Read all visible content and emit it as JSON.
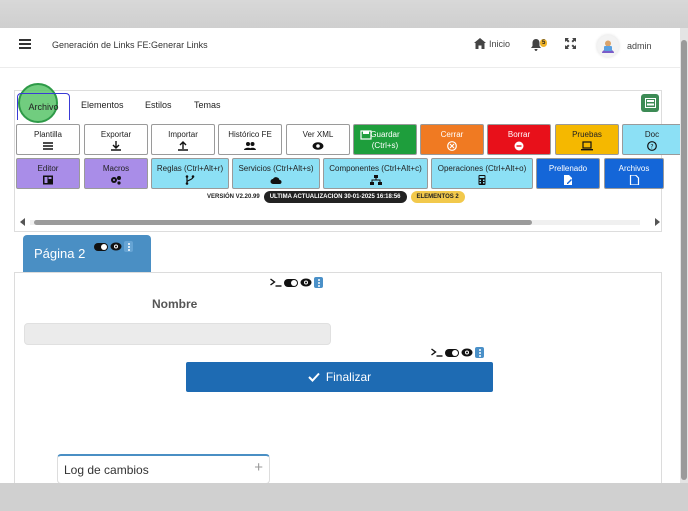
{
  "header": {
    "title": "Generación de Links FE:Generar Links",
    "home_label": "Inicio",
    "notification_count": "5",
    "user_name": "admin"
  },
  "editor": {
    "tabs": [
      "Archivo",
      "Elementos",
      "Estilos",
      "Temas"
    ],
    "active_tab": "Archivo",
    "row1": [
      {
        "line1": "Plantilla",
        "line2": "",
        "icon": "list-icon",
        "color": "#ffffff"
      },
      {
        "line1": "Exportar",
        "line2": "",
        "icon": "download-icon",
        "color": "#ffffff"
      },
      {
        "line1": "Importar",
        "line2": "",
        "icon": "upload-icon",
        "color": "#ffffff"
      },
      {
        "line1": "Histórico FE",
        "line2": "",
        "icon": "users-icon",
        "color": "#ffffff"
      },
      {
        "line1": "Ver XML",
        "line2": "",
        "icon": "eye-icon",
        "color": "#ffffff"
      },
      {
        "line1": "Guardar",
        "line2": "(Ctrl+s)",
        "icon": "save-icon",
        "color": "#1e9e3c"
      },
      {
        "line1": "Cerrar",
        "line2": "",
        "icon": "close-circle-icon",
        "color": "#f07a22"
      },
      {
        "line1": "Borrar",
        "line2": "",
        "icon": "minus-circle-icon",
        "color": "#e8101a"
      },
      {
        "line1": "Pruebas",
        "line2": "",
        "icon": "laptop-icon",
        "color": "#f5b800"
      },
      {
        "line1": "Doc",
        "line2": "",
        "icon": "help-circle-icon",
        "color": "#8ce0f5"
      }
    ],
    "row2": [
      {
        "line1": "Editor",
        "line2": "",
        "icon": "layout-icon",
        "color": "#a98de8"
      },
      {
        "line1": "Macros",
        "line2": "",
        "icon": "gears-icon",
        "color": "#a98de8"
      },
      {
        "line1": "Reglas (Ctrl+Alt+r)",
        "line2": "",
        "icon": "branch-icon",
        "color": "#8ce0f5"
      },
      {
        "line1": "Servicios (Ctrl+Alt+s)",
        "line2": "",
        "icon": "cloud-icon",
        "color": "#8ce0f5"
      },
      {
        "line1": "Componentes (Ctrl+Alt+c)",
        "line2": "",
        "icon": "sitemap-icon",
        "color": "#8ce0f5"
      },
      {
        "line1": "Operaciones (Ctrl+Alt+o)",
        "line2": "",
        "icon": "calculator-icon",
        "color": "#8ce0f5"
      },
      {
        "line1": "Prellenado",
        "line2": "",
        "icon": "file-edit-icon",
        "color": "#1466d8"
      },
      {
        "line1": "Archivos",
        "line2": "",
        "icon": "file-icon",
        "color": "#1466d8"
      }
    ],
    "version": "VERSIÓN V2.20.99",
    "last_update": "ULTIMA ACTUALIZACION 30-01-2025 16:18:56",
    "elements": "ELEMENTOS 2"
  },
  "page": {
    "tab_label": "Página 2",
    "field_label": "Nombre",
    "finalize_label": "Finalizar",
    "log_label": "Log de cambios"
  },
  "colors": {
    "accent": "#1e6bb3",
    "page_tab": "#4a8fc4",
    "highlight": "#58c468"
  }
}
